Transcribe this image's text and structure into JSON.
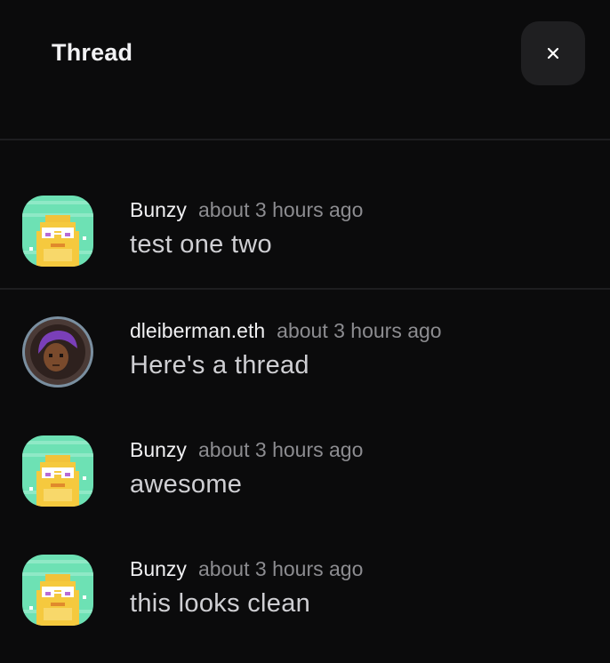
{
  "panel": {
    "title": "Thread",
    "close_icon": "close-icon"
  },
  "messages": [
    {
      "author": "Bunzy",
      "time": "about 3 hours ago",
      "text": "test one two",
      "avatar": "bunzy-avatar"
    },
    {
      "author": "dleiberman.eth",
      "time": "about 3 hours ago",
      "text": "Here's a thread",
      "avatar": "dleiberman-avatar"
    },
    {
      "author": "Bunzy",
      "time": "about 3 hours ago",
      "text": "awesome",
      "avatar": "bunzy-avatar"
    },
    {
      "author": "Bunzy",
      "time": "about 3 hours ago",
      "text": "this looks clean",
      "avatar": "bunzy-avatar"
    }
  ]
}
